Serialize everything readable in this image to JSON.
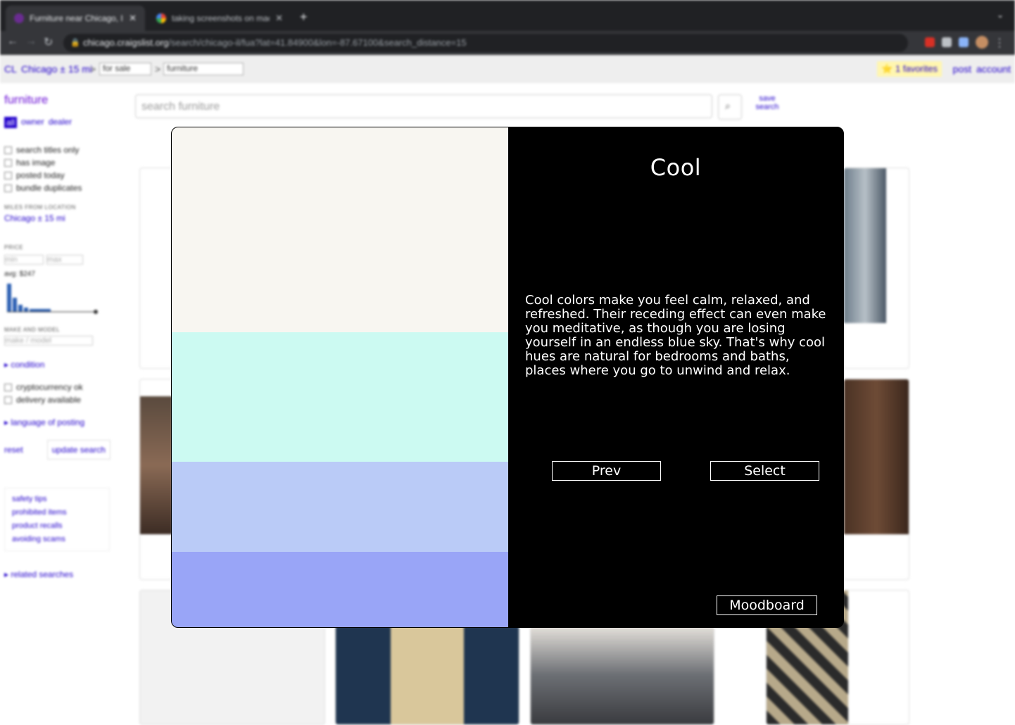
{
  "browser": {
    "tabs": [
      {
        "title": "Furniture near Chicago, IL - cr",
        "active": true
      },
      {
        "title": "taking screenshots on mac - G",
        "active": false
      }
    ],
    "url_host": "chicago.craigslist.org",
    "url_path": "/search/chicago-il/fua?lat=41.84900&lon=-87.67100&search_distance=15"
  },
  "craigslist": {
    "logo": "CL",
    "location": "Chicago ± 15 mi",
    "sep": ">",
    "category_select": "for sale",
    "subcategory_select": "furniture",
    "favorites": "⭐ 1 favorites",
    "post": "post",
    "account": "account",
    "search_placeholder": "search furniture",
    "save_search": "save search",
    "sidebar": {
      "heading": "furniture",
      "tabs": [
        "all",
        "owner",
        "dealer"
      ],
      "checks": [
        "search titles only",
        "has image",
        "posted today",
        "bundle duplicates"
      ],
      "miles_label": "MILES FROM LOCATION",
      "miles_value": "Chicago ± 15 mi",
      "price_label": "PRICE",
      "price_min": "min",
      "price_max": "max",
      "avg": "avg: $247",
      "make_label": "MAKE AND MODEL",
      "make_placeholder": "make / model",
      "condition": "▸ condition",
      "checks2": [
        "cryptocurrency ok",
        "delivery available"
      ],
      "language": "▸ language of posting",
      "reset": "reset",
      "update": "update search",
      "links": [
        "safety tips",
        "prohibited items",
        "product recalls",
        "avoiding scams"
      ],
      "related": "▸ related searches"
    }
  },
  "modal": {
    "title": "Cool",
    "description": "Cool colors make you feel calm, relaxed, and refreshed. Their receding effect can even make you meditative, as though you are losing yourself in an endless blue sky. That's why cool hues are natural for bedrooms and baths, places where you go to unwind and relax.",
    "prev_label": "Prev",
    "select_label": "Select",
    "moodboard_label": "Moodboard",
    "swatches": [
      {
        "color": "#f8f6f1",
        "share": 0.41
      },
      {
        "color": "#ccfaf2",
        "share": 0.26
      },
      {
        "color": "#bacbf7",
        "share": 0.18
      },
      {
        "color": "#99a5f7",
        "share": 0.15
      }
    ]
  }
}
